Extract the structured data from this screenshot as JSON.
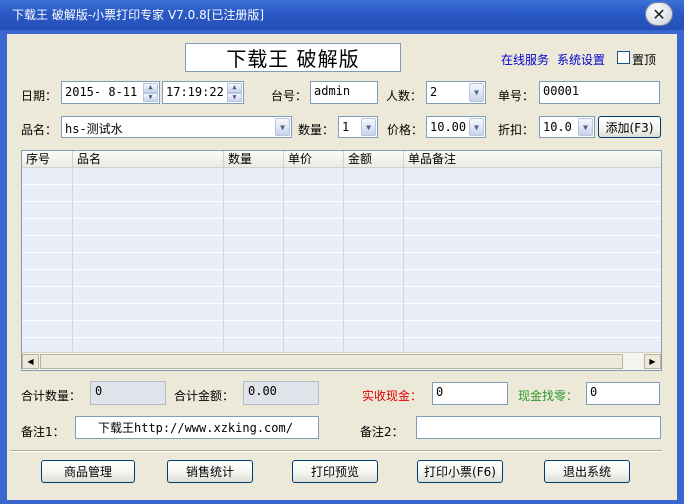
{
  "window": {
    "title": "下载王 破解版-小票打印专家 V7.0.8[已注册版]",
    "close_glyph": "✕"
  },
  "header": {
    "banner": "下载王 破解版",
    "online_service": "在线服务",
    "system_settings": "系统设置",
    "pin_top_label": "置顶",
    "pin_top_checked": false
  },
  "row1": {
    "date_label": "日期：",
    "date_value": "2015- 8-11",
    "time_value": "17:19:22",
    "register_label": "台号：",
    "register_value": "admin",
    "people_label": "人数：",
    "people_value": "2",
    "order_no_label": "单号：",
    "order_no_value": "00001"
  },
  "row2": {
    "product_label": "品名：",
    "product_value": "hs-测试水",
    "qty_label": "数量：",
    "qty_value": "1",
    "price_label": "价格：",
    "price_value": "10.00",
    "discount_label": "折扣：",
    "discount_value": "10.0",
    "add_button": "添加(F3)"
  },
  "grid": {
    "columns": [
      "序号",
      "品名",
      "数量",
      "单价",
      "金额",
      "单品备注"
    ],
    "rows": []
  },
  "totals": {
    "total_qty_label": "合计数量：",
    "total_qty_value": "0",
    "total_amount_label": "合计金额：",
    "total_amount_value": "0.00",
    "cash_received_label": "实收现金：",
    "cash_received_value": "0",
    "change_label": "现金找零：",
    "change_value": "0"
  },
  "notes": {
    "note1_label": "备注1：",
    "note1_value": "下载王http://www.xzking.com/",
    "note2_label": "备注2：",
    "note2_value": ""
  },
  "footer": {
    "btn_products": "商品管理",
    "btn_sales": "销售统计",
    "btn_preview": "打印预览",
    "btn_print": "打印小票(F6)",
    "btn_exit": "退出系统"
  },
  "colors": {
    "titlebar": "#2a5ac6",
    "window_bg": "#ece9d8",
    "link": "#0000cc",
    "cash_label": "#e00000",
    "change_label": "#2c9a2c"
  },
  "icons": {
    "close": "close-icon",
    "dropdown": "chevron-down-icon",
    "spinner": "spin-up-down-icon",
    "scroll_left": "arrow-left-icon",
    "scroll_right": "arrow-right-icon"
  }
}
